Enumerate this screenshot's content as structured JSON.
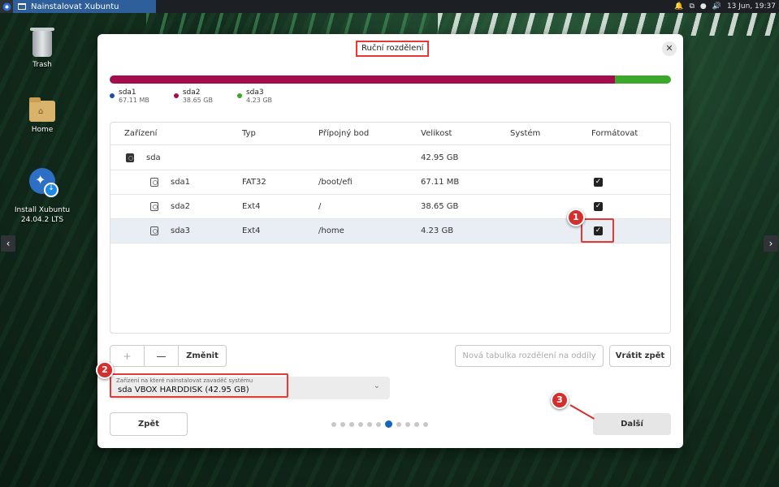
{
  "panel": {
    "task_title": "Nainstalovat Xubuntu",
    "clock": "13 Jun, 19:37"
  },
  "desktop": {
    "icons": [
      {
        "label": "Trash"
      },
      {
        "label": "Home"
      },
      {
        "label": "Install Xubuntu\n24.04.2 LTS"
      }
    ]
  },
  "dialog": {
    "title": "Ruční rozdělení",
    "close_glyph": "✕",
    "legend": [
      {
        "name": "sda1",
        "size": "67.11 MB",
        "color": "#1a4fa0"
      },
      {
        "name": "sda2",
        "size": "38.65 GB",
        "color": "#a30d4b"
      },
      {
        "name": "sda3",
        "size": "4.23 GB",
        "color": "#3ba82b"
      }
    ],
    "table": {
      "headers": [
        "Zařízení",
        "Typ",
        "Přípojný bod",
        "Velikost",
        "Systém",
        "Formátovat"
      ],
      "rows": [
        {
          "device": "sda",
          "type": "",
          "mount": "",
          "size": "42.95 GB",
          "system": "",
          "format": false
        },
        {
          "device": "sda1",
          "type": "FAT32",
          "mount": "/boot/efi",
          "size": "67.11 MB",
          "system": "",
          "format": true
        },
        {
          "device": "sda2",
          "type": "Ext4",
          "mount": "/",
          "size": "38.65 GB",
          "system": "",
          "format": true
        },
        {
          "device": "sda3",
          "type": "Ext4",
          "mount": "/home",
          "size": "4.23 GB",
          "system": "",
          "format": true
        }
      ]
    },
    "toolbar": {
      "add": "+",
      "remove": "—",
      "change": "Změnit"
    },
    "new_table_button": "Nová tabulka rozdělení na oddíly",
    "revert_button": "Vrátit zpět",
    "bootloader": {
      "caption": "Zařízení na které nainstalovat zavaděč systému",
      "value": "sda VBOX HARDDISK (42.95 GB)"
    },
    "back_button": "Zpět",
    "next_button": "Další",
    "progress": {
      "total_steps": 11,
      "current_step": 7
    },
    "badges": [
      "1",
      "2",
      "3"
    ],
    "annotation_color": "#e53935"
  }
}
